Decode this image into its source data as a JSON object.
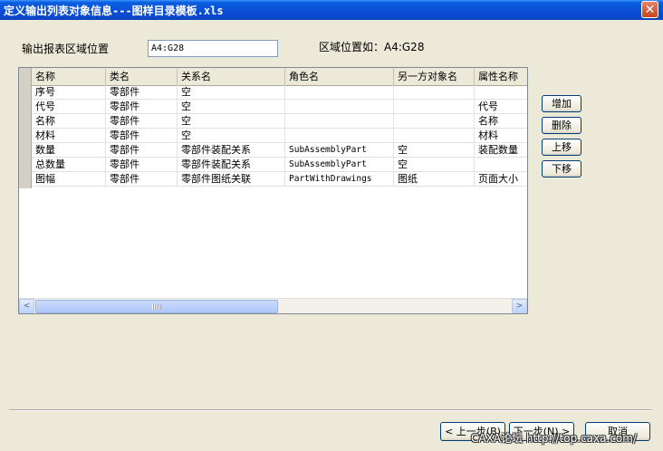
{
  "window": {
    "title": "定义输出列表对象信息---图样目录模板.xls",
    "close_glyph": "✕"
  },
  "form": {
    "range_label": "输出报表区域位置",
    "range_value": "A4:G28",
    "example_label": "区域位置如：A4:G28"
  },
  "table": {
    "columns": [
      "名称",
      "类名",
      "关系名",
      "角色名",
      "另一方对象名",
      "属性名称"
    ],
    "rows": [
      [
        "序号",
        "零部件",
        "空",
        "",
        "",
        ""
      ],
      [
        "代号",
        "零部件",
        "空",
        "",
        "",
        "代号"
      ],
      [
        "名称",
        "零部件",
        "空",
        "",
        "",
        "名称"
      ],
      [
        "材料",
        "零部件",
        "空",
        "",
        "",
        "材料"
      ],
      [
        "数量",
        "零部件",
        "零部件装配关系",
        "SubAssemblyPart",
        "空",
        "装配数量"
      ],
      [
        "总数量",
        "零部件",
        "零部件装配关系",
        "SubAssemblyPart",
        "空",
        ""
      ],
      [
        "图幅",
        "零部件",
        "零部件图纸关联",
        "PartWithDrawings",
        "图纸",
        "页面大小"
      ]
    ],
    "scroll_left": "<",
    "scroll_right": ">"
  },
  "side_buttons": {
    "add": "增加",
    "delete": "删除",
    "up": "上移",
    "down": "下移"
  },
  "footer": {
    "prev": "< 上一步(B)",
    "next": "下一步(N) >",
    "cancel": "取消"
  },
  "watermark": "CAXA论坛 http://top.caxa.com/"
}
